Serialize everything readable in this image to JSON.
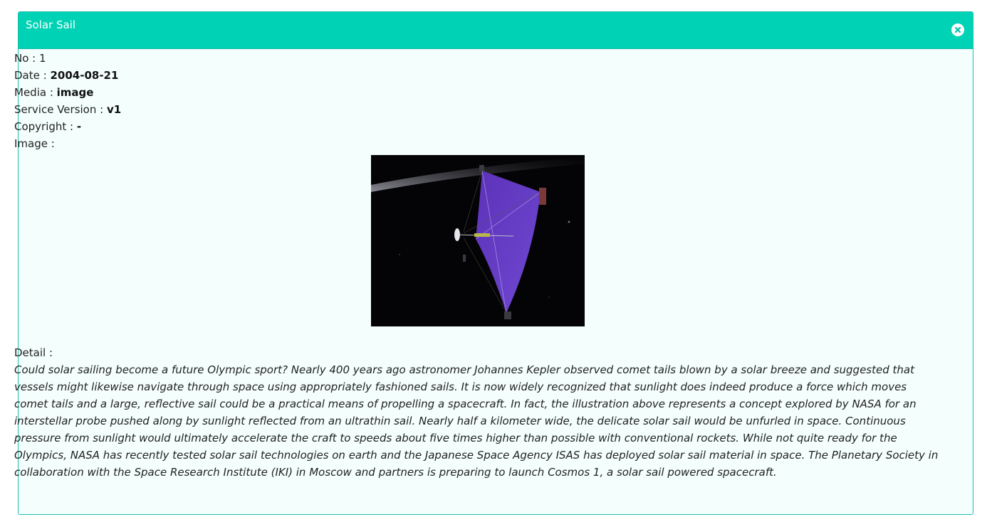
{
  "dialog": {
    "title": "Solar Sail",
    "close_icon": "close-icon"
  },
  "fields": {
    "no_label": "No :",
    "no_value": "1",
    "date_label": "Date :",
    "date_value": "2004-08-21",
    "media_label": "Media :",
    "media_value": "image",
    "service_version_label": "Service Version :",
    "service_version_value": "v1",
    "copyright_label": "Copyright :",
    "copyright_value": "-",
    "image_label": "Image :"
  },
  "detail": {
    "label": "Detail :",
    "text": "Could solar sailing become a future Olympic sport? Nearly 400 years ago astronomer Johannes Kepler observed comet tails blown by a solar breeze and suggested that vessels might likewise navigate through space using appropriately fashioned sails. It is now widely recognized that sunlight does indeed produce a force which moves comet tails and a large, reflective sail could be a practical means of propelling a spacecraft. In fact, the illustration above represents a concept explored by NASA for an interstellar probe pushed along by sunlight reflected from an ultrathin sail. Nearly half a kilometer wide, the delicate solar sail would be unfurled in space. Continuous pressure from sunlight would ultimately accelerate the craft to speeds about five times higher than possible with conventional rockets. While not quite ready for the Olympics, NASA has recently tested solar sail technologies on earth and the Japanese Space Agency ISAS has deployed solar sail material in space. The Planetary Society in collaboration with the Space Research Institute (IKI) in Moscow and partners is preparing to launch Cosmos 1, a solar sail powered spacecraft."
  },
  "colors": {
    "header_bg": "#00d2b5",
    "panel_bg": "#f3fefd",
    "sail": "#6a40c8"
  }
}
